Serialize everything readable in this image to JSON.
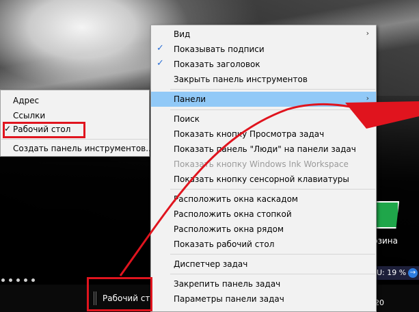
{
  "desktop": {
    "recycle_bin_label": "рзина",
    "cpu_indicator": "U: 19 %",
    "tray_time": "20",
    "colors": {
      "annotation_red": "#e0141e",
      "highlight": "#91c9f7",
      "check_blue": "#2b6fd6"
    }
  },
  "taskbar": {
    "toolbar_label": "Рабочий сто"
  },
  "submenu": {
    "items": [
      {
        "label": "Адрес",
        "checked": false
      },
      {
        "label": "Ссылки",
        "checked": false
      },
      {
        "label": "Рабочий стол",
        "checked": true
      }
    ],
    "create_toolbar": "Создать панель инструментов..."
  },
  "context_menu": {
    "view": "Вид",
    "show_labels": "Показывать подписи",
    "show_title": "Показать заголовок",
    "close_toolbar": "Закрыть панель инструментов",
    "panels": "Панели",
    "search": "Поиск",
    "task_view": "Показать кнопку Просмотра задач",
    "people": "Показать панель \"Люди\" на панели задач",
    "ink": "Показать кнопку Windows Ink Workspace",
    "touch_keyboard": "Показать кнопку сенсорной клавиатуры",
    "cascade": "Расположить окна каскадом",
    "stack": "Расположить окна стопкой",
    "side_by_side": "Расположить окна рядом",
    "show_desktop": "Показать рабочий стол",
    "task_manager": "Диспетчер задач",
    "lock_taskbar": "Закрепить панель задач",
    "taskbar_settings": "Параметры панели задач",
    "check_glyph": "✓",
    "arrow_glyph": "›"
  }
}
